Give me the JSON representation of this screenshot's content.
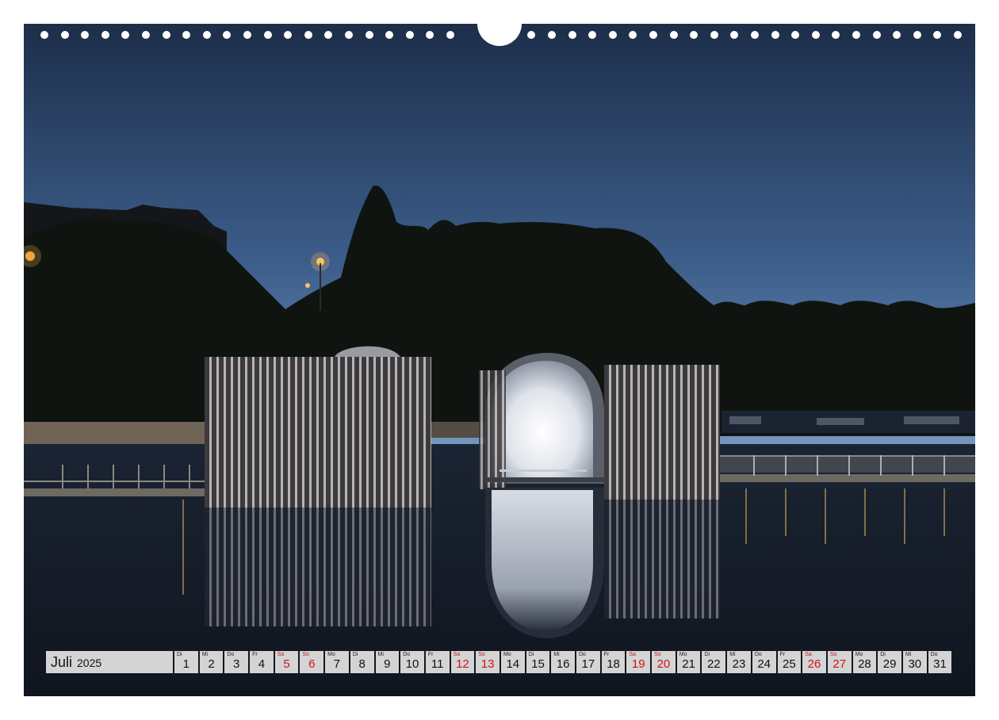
{
  "calendar": {
    "month": "Juli",
    "year": "2025",
    "days": [
      {
        "d": "1",
        "w": "Di",
        "we": false
      },
      {
        "d": "2",
        "w": "Mi",
        "we": false
      },
      {
        "d": "3",
        "w": "Do",
        "we": false
      },
      {
        "d": "4",
        "w": "Fr",
        "we": false
      },
      {
        "d": "5",
        "w": "Sa",
        "we": true
      },
      {
        "d": "6",
        "w": "So",
        "we": true
      },
      {
        "d": "7",
        "w": "Mo",
        "we": false
      },
      {
        "d": "8",
        "w": "Di",
        "we": false
      },
      {
        "d": "9",
        "w": "Mi",
        "we": false
      },
      {
        "d": "10",
        "w": "Do",
        "we": false
      },
      {
        "d": "11",
        "w": "Fr",
        "we": false
      },
      {
        "d": "12",
        "w": "Sa",
        "we": true
      },
      {
        "d": "13",
        "w": "So",
        "we": true
      },
      {
        "d": "14",
        "w": "Mo",
        "we": false
      },
      {
        "d": "15",
        "w": "Di",
        "we": false
      },
      {
        "d": "16",
        "w": "Mi",
        "we": false
      },
      {
        "d": "17",
        "w": "Do",
        "we": false
      },
      {
        "d": "18",
        "w": "Fr",
        "we": false
      },
      {
        "d": "19",
        "w": "Sa",
        "we": true
      },
      {
        "d": "20",
        "w": "So",
        "we": true
      },
      {
        "d": "21",
        "w": "Mo",
        "we": false
      },
      {
        "d": "22",
        "w": "Di",
        "we": false
      },
      {
        "d": "23",
        "w": "Mi",
        "we": false
      },
      {
        "d": "24",
        "w": "Do",
        "we": false
      },
      {
        "d": "25",
        "w": "Fr",
        "we": false
      },
      {
        "d": "26",
        "w": "Sa",
        "we": true
      },
      {
        "d": "27",
        "w": "So",
        "we": true
      },
      {
        "d": "28",
        "w": "Mo",
        "we": false
      },
      {
        "d": "29",
        "w": "Di",
        "we": false
      },
      {
        "d": "30",
        "w": "Mi",
        "we": false
      },
      {
        "d": "31",
        "w": "Do",
        "we": false
      }
    ]
  },
  "colors": {
    "sky_top": "#1f3350",
    "sky_bottom": "#6a8fba",
    "water": "#151c27",
    "weekend": "#d0121b",
    "cell": "#d4d4d4"
  }
}
